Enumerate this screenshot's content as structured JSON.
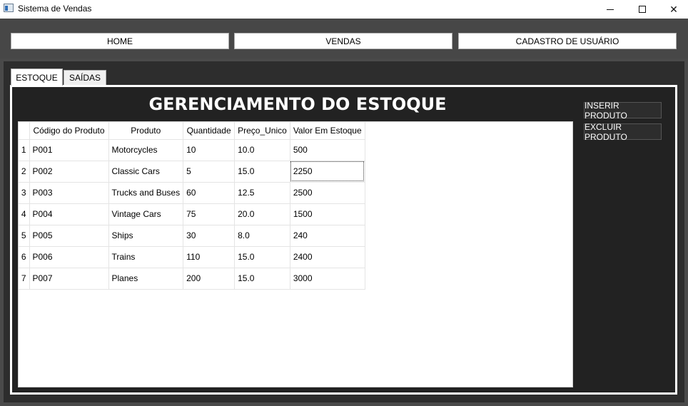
{
  "window": {
    "title": "Sistema de Vendas"
  },
  "nav": {
    "home": "HOME",
    "vendas": "VENDAS",
    "cadastro": "CADASTRO DE USUÁRIO"
  },
  "tabs": {
    "estoque": "ESTOQUE",
    "saidas": "SAÍDAS"
  },
  "panel": {
    "heading": "GERENCIAMENTO DO ESTOQUE",
    "insert_button": "INSERIR PRODUTO",
    "delete_button": "EXCLUIR PRODUTO"
  },
  "table": {
    "headers": [
      "Código do Produto",
      "Produto",
      "Quantidade",
      "Preço_Unico",
      "Valor Em Estoque"
    ],
    "rows": [
      {
        "num": "1",
        "codigo": "P001",
        "produto": "Motorcycles",
        "quantidade": "10",
        "preco": "10.0",
        "valor": "500"
      },
      {
        "num": "2",
        "codigo": "P002",
        "produto": "Classic Cars",
        "quantidade": "5",
        "preco": "15.0",
        "valor": "2250"
      },
      {
        "num": "3",
        "codigo": "P003",
        "produto": "Trucks and Buses",
        "quantidade": "60",
        "preco": "12.5",
        "valor": "2500"
      },
      {
        "num": "4",
        "codigo": "P004",
        "produto": "Vintage Cars",
        "quantidade": "75",
        "preco": "20.0",
        "valor": "1500"
      },
      {
        "num": "5",
        "codigo": "P005",
        "produto": "Ships",
        "quantidade": "30",
        "preco": "8.0",
        "valor": "240"
      },
      {
        "num": "6",
        "codigo": "P006",
        "produto": "Trains",
        "quantidade": "110",
        "preco": "15.0",
        "valor": "2400"
      },
      {
        "num": "7",
        "codigo": "P007",
        "produto": "Planes",
        "quantidade": "200",
        "preco": "15.0",
        "valor": "3000"
      }
    ]
  },
  "icons": {
    "app": "app-window-icon",
    "minimize": "minimize-icon",
    "maximize": "maximize-icon",
    "close": "close-icon"
  }
}
